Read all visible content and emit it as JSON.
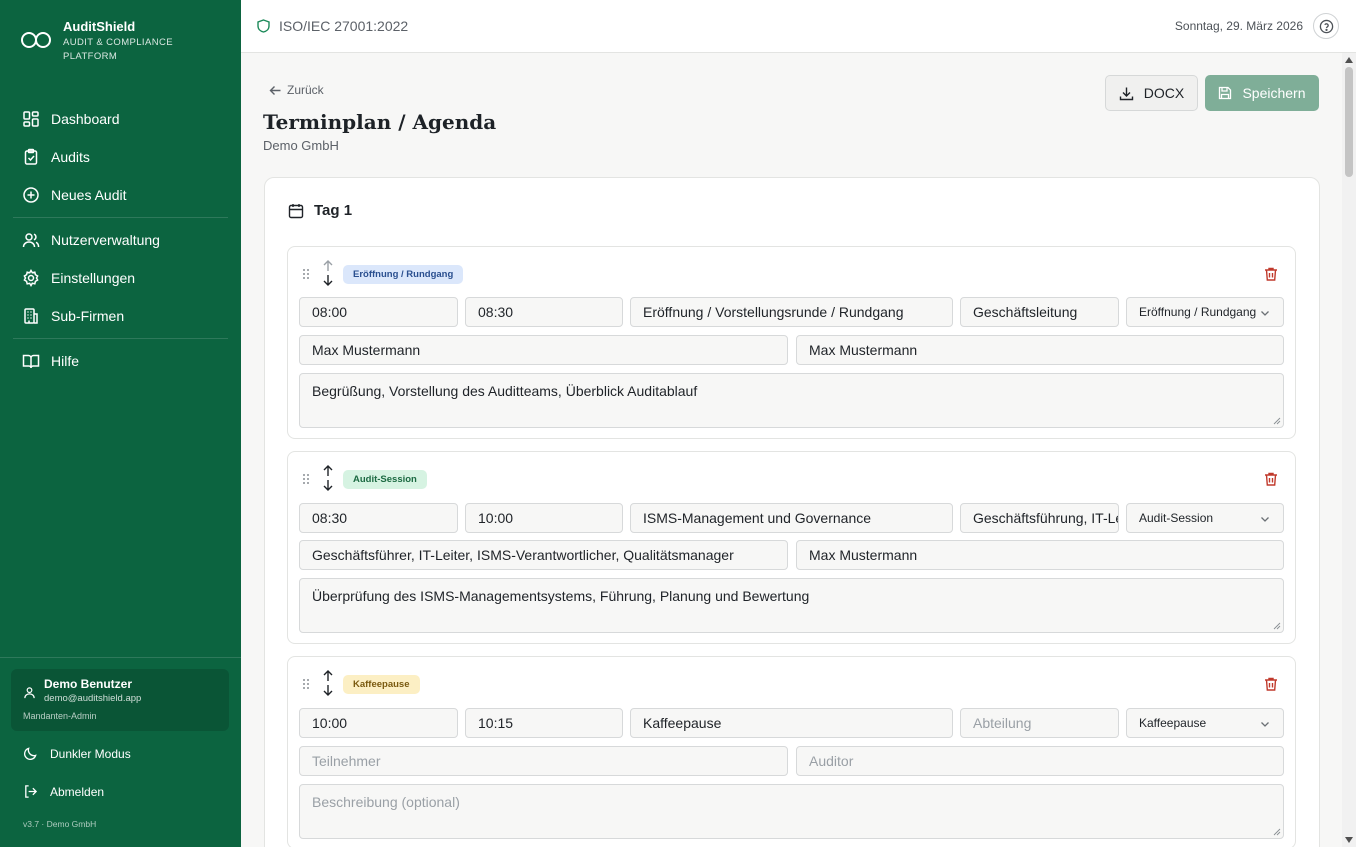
{
  "app": {
    "name": "AuditShield",
    "subtitle": "AUDIT & COMPLIANCE PLATFORM"
  },
  "sidebar": {
    "nav": [
      {
        "label": "Dashboard",
        "icon": "dashboard-icon"
      },
      {
        "label": "Audits",
        "icon": "clipboard-check-icon"
      },
      {
        "label": "Neues Audit",
        "icon": "plus-circle-icon"
      },
      {
        "label": "Nutzerverwaltung",
        "icon": "users-icon"
      },
      {
        "label": "Einstellungen",
        "icon": "gear-icon"
      },
      {
        "label": "Sub-Firmen",
        "icon": "building-icon"
      },
      {
        "label": "Hilfe",
        "icon": "book-icon"
      }
    ],
    "user": {
      "name": "Demo Benutzer",
      "email": "demo@auditshield.app",
      "role": "Mandanten-Admin"
    },
    "dark_mode_label": "Dunkler Modus",
    "logout_label": "Abmelden",
    "version": "v3.7 · Demo GmbH"
  },
  "topbar": {
    "standard": "ISO/IEC 27001:2022",
    "date": "Sonntag, 29. März 2026"
  },
  "page": {
    "back_label": "Zurück",
    "title": "Terminplan / Agenda",
    "subtitle": "Demo GmbH",
    "docx_label": "DOCX",
    "save_label": "Speichern"
  },
  "day": {
    "title": "Tag 1",
    "items": [
      {
        "badge": "Eröffnung / Rundgang",
        "badge_bg": "#dbe7fb",
        "badge_color": "#2a4f8f",
        "start": "08:00",
        "end": "08:30",
        "topic": "Eröffnung / Vorstellungsrunde / Rundgang",
        "department": "Geschäftsleitung",
        "type": "Eröffnung / Rundgang",
        "participants": "Max Mustermann",
        "auditor": "Max Mustermann",
        "description": "Begrüßung, Vorstellung des Auditteams, Überblick Auditablauf"
      },
      {
        "badge": "Audit-Session",
        "badge_bg": "#d6f3e2",
        "badge_color": "#1c6a42",
        "start": "08:30",
        "end": "10:00",
        "topic": "ISMS-Management und Governance",
        "department": "Geschäftsführung, IT-Leitung",
        "type": "Audit-Session",
        "participants": "Geschäftsführer, IT-Leiter, ISMS-Verantwortlicher, Qualitätsmanager",
        "auditor": "Max Mustermann",
        "description": "Überprüfung des ISMS-Managementsystems, Führung, Planung und Bewertung"
      },
      {
        "badge": "Kaffeepause",
        "badge_bg": "#fcefc4",
        "badge_color": "#7a5a10",
        "start": "10:00",
        "end": "10:15",
        "topic": "Kaffeepause",
        "department": "",
        "department_placeholder": "Abteilung",
        "type": "Kaffeepause",
        "participants": "",
        "participants_placeholder": "Teilnehmer",
        "auditor": "",
        "auditor_placeholder": "Auditor",
        "description": "",
        "description_placeholder": "Beschreibung (optional)"
      }
    ]
  },
  "colors": {
    "sidebar": "#0c6440",
    "save_button": "#7fae98",
    "delete": "#c0392b"
  }
}
